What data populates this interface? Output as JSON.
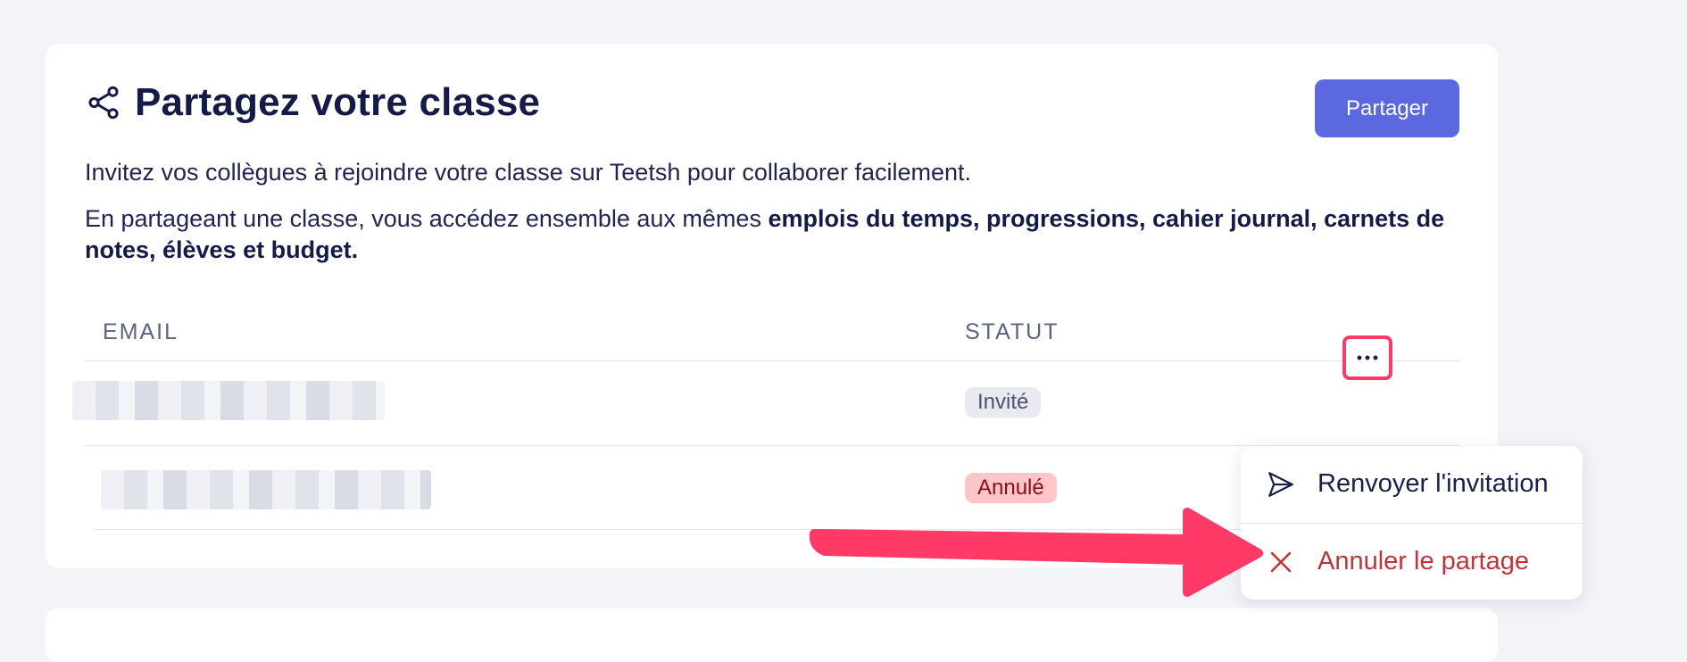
{
  "share_card": {
    "title": "Partagez votre classe",
    "share_button": "Partager",
    "intro": "Invitez vos collègues à rejoindre votre classe sur Teetsh pour collaborer facilement.",
    "details_prefix": "En partageant une classe, vous accédez ensemble aux mêmes ",
    "details_bold": "emplois du temps, progressions, cahier journal, carnets de notes, élèves et budget."
  },
  "table": {
    "columns": [
      "EMAIL",
      "STATUT"
    ],
    "rows": [
      {
        "status": "Invité"
      },
      {
        "status": "Annulé"
      }
    ]
  },
  "context_menu": {
    "more_label": "···",
    "items": [
      {
        "label": "Renvoyer l'invitation",
        "icon": "send-icon"
      },
      {
        "label": "Annuler le partage",
        "icon": "close-icon"
      }
    ]
  },
  "colors": {
    "accent": "#5b68df",
    "highlight": "#ff3a67",
    "danger_text": "#c0353c",
    "cancel_badge": "#ffc5c7"
  }
}
